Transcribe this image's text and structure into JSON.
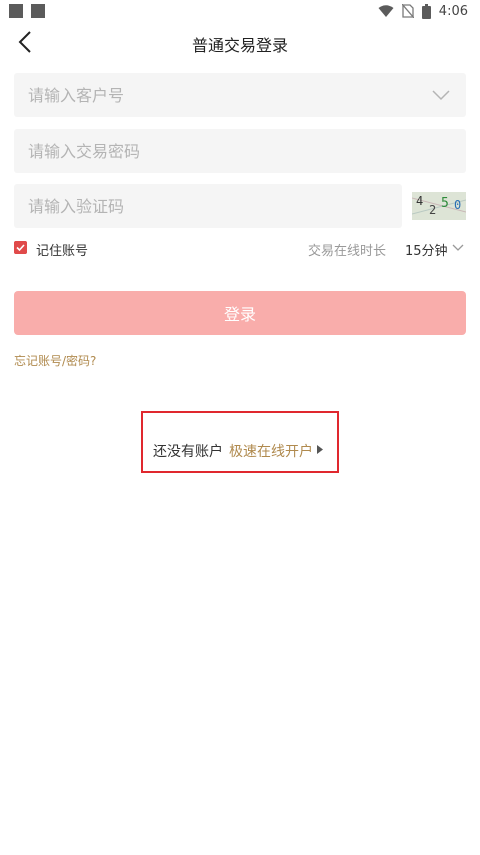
{
  "status_bar": {
    "time": "4:06"
  },
  "header": {
    "title": "普通交易登录"
  },
  "form": {
    "customer_no_placeholder": "请输入客户号",
    "password_placeholder": "请输入交易密码",
    "captcha_placeholder": "请输入验证码",
    "captcha_text": "4250"
  },
  "remember": {
    "label": "记住账号",
    "checked": true,
    "duration_label": "交易在线时长",
    "duration_value": "15分钟"
  },
  "login_button": "登录",
  "forgot_link": "忘记账号/密码?",
  "open_account": {
    "prompt": "还没有账户",
    "link": "极速在线开户"
  },
  "colors": {
    "accent": "#e04a4a",
    "login_button_bg": "#f9adab",
    "link": "#b08a4e",
    "highlight_border": "#e0282e"
  }
}
